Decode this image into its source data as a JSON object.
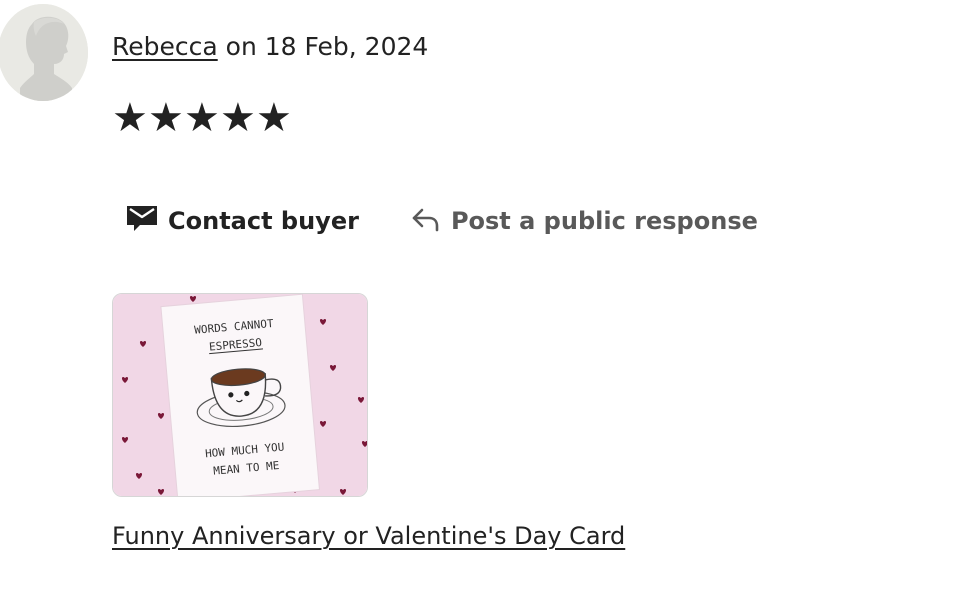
{
  "review": {
    "reviewer_name": "Rebecca",
    "date_text": "on 18 Feb, 2024",
    "stars": [
      "★",
      "★",
      "★",
      "★",
      "★"
    ]
  },
  "actions": {
    "contact_label": "Contact buyer",
    "public_response_label": "Post a public response"
  },
  "product": {
    "title": "Funny Anniversary or Valentine's Day Card",
    "card_text_top_1": "WORDS CANNOT",
    "card_text_top_2": "ESPRESSO",
    "card_text_bottom_1": "HOW MUCH YOU",
    "card_text_bottom_2": "MEAN TO ME"
  },
  "colors": {
    "text": "#222222",
    "muted": "#595959",
    "thumb_bg": "#f1d7e6",
    "heart": "#7a1838"
  },
  "icons": {
    "contact": "envelope-icon",
    "public": "reply-arrow-icon"
  }
}
